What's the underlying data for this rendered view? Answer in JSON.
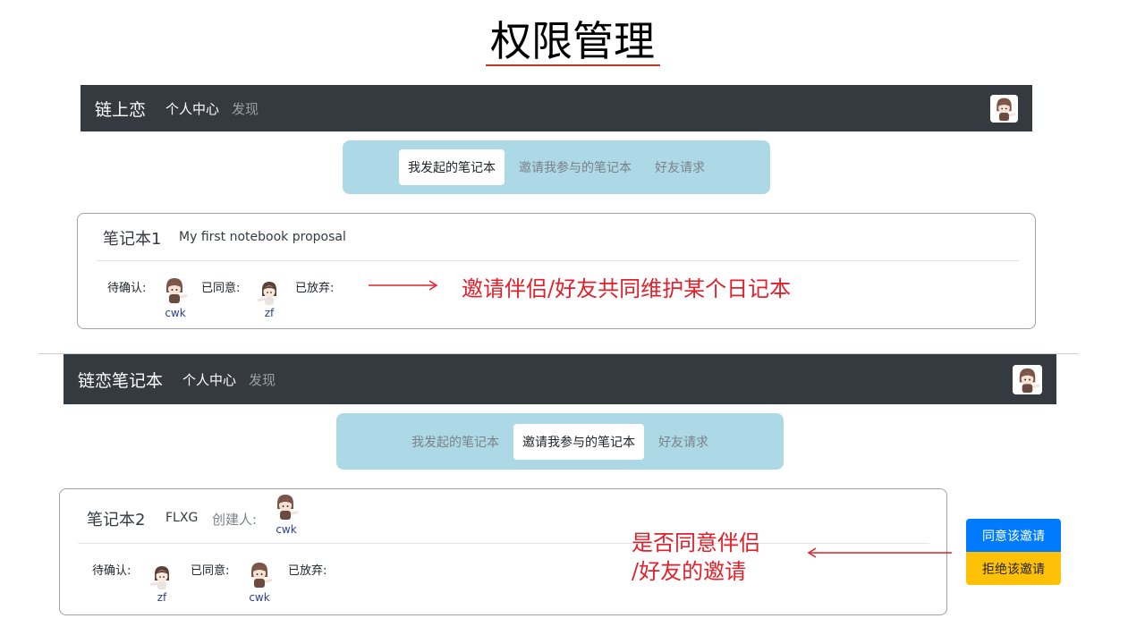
{
  "page_title": "权限管理",
  "top": {
    "navbar": {
      "brand": "链上恋",
      "active_link": "个人中心",
      "link": "发现",
      "avatar_icon": "user-avatar"
    },
    "tabs": [
      {
        "label": "我发起的笔记本",
        "active": true
      },
      {
        "label": "邀请我参与的笔记本",
        "active": false
      },
      {
        "label": "好友请求",
        "active": false
      }
    ],
    "card": {
      "name": "笔记本1",
      "description": "My first notebook proposal",
      "pending_label": "待确认:",
      "pending_user": "cwk",
      "agreed_label": "已同意:",
      "agreed_user": "zf",
      "abandoned_label": "已放弃:"
    },
    "annotation": "邀请伴侣/好友共同维护某个日记本"
  },
  "bottom": {
    "navbar": {
      "brand": "链恋笔记本",
      "active_link": "个人中心",
      "link": "发现",
      "avatar_icon": "user-avatar"
    },
    "tabs": [
      {
        "label": "我发起的笔记本",
        "active": false
      },
      {
        "label": "邀请我参与的笔记本",
        "active": true
      },
      {
        "label": "好友请求",
        "active": false
      }
    ],
    "card": {
      "name": "笔记本2",
      "description": "FLXG",
      "creator_label": "创建人:",
      "creator_user": "cwk",
      "pending_label": "待确认:",
      "pending_user": "zf",
      "agreed_label": "已同意:",
      "agreed_user": "cwk",
      "abandoned_label": "已放弃:"
    },
    "annotation_line1": "是否同意伴侣",
    "annotation_line2": "/好友的邀请",
    "accept_button": "同意该邀请",
    "reject_button": "拒绝该邀请"
  },
  "colors": {
    "navbar": "#343a40",
    "tabbar": "#add8e6",
    "annotation": "#e0202a",
    "primary": "#007bff",
    "warning": "#ffc107"
  }
}
